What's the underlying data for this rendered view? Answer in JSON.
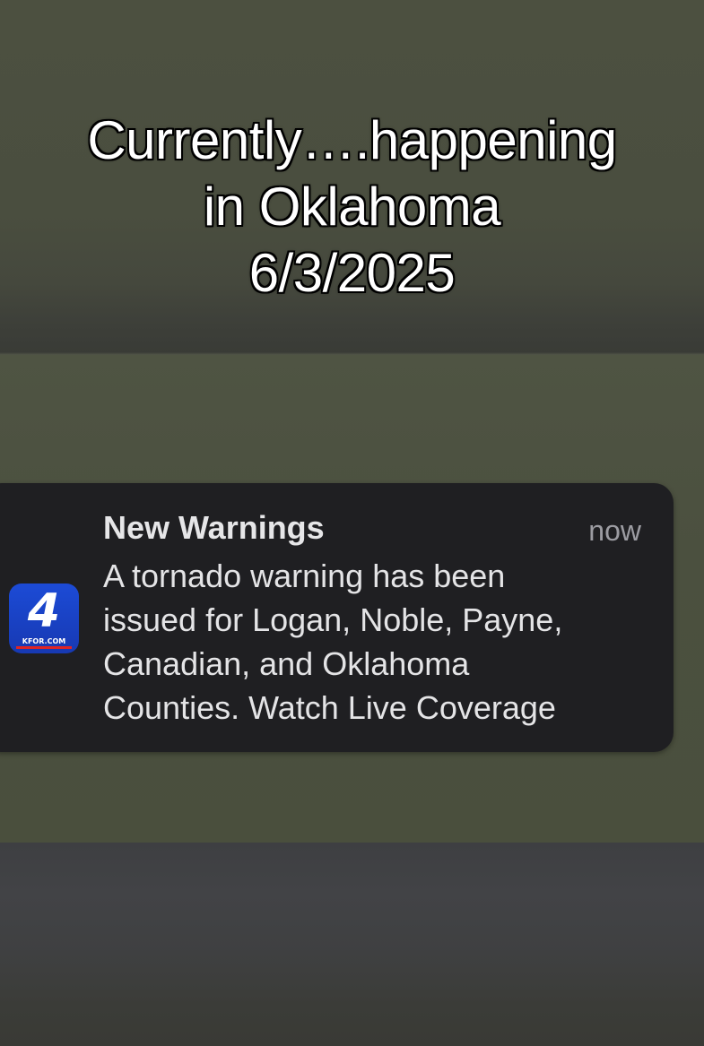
{
  "caption": {
    "lines": [
      "Currently….happening",
      "in Oklahoma",
      "6/3/2025"
    ]
  },
  "notification": {
    "app_icon": {
      "name": "kfor-4-app-icon",
      "number": "4",
      "brand": "KFOR.COM",
      "color": "#1c4bd6"
    },
    "title": "New Warnings",
    "time": "now",
    "body_lines": [
      "A tornado warning has been",
      "issued for Logan, Noble, Payne,",
      "Canadian, and Oklahoma",
      "Counties. Watch Live Coverage"
    ]
  }
}
